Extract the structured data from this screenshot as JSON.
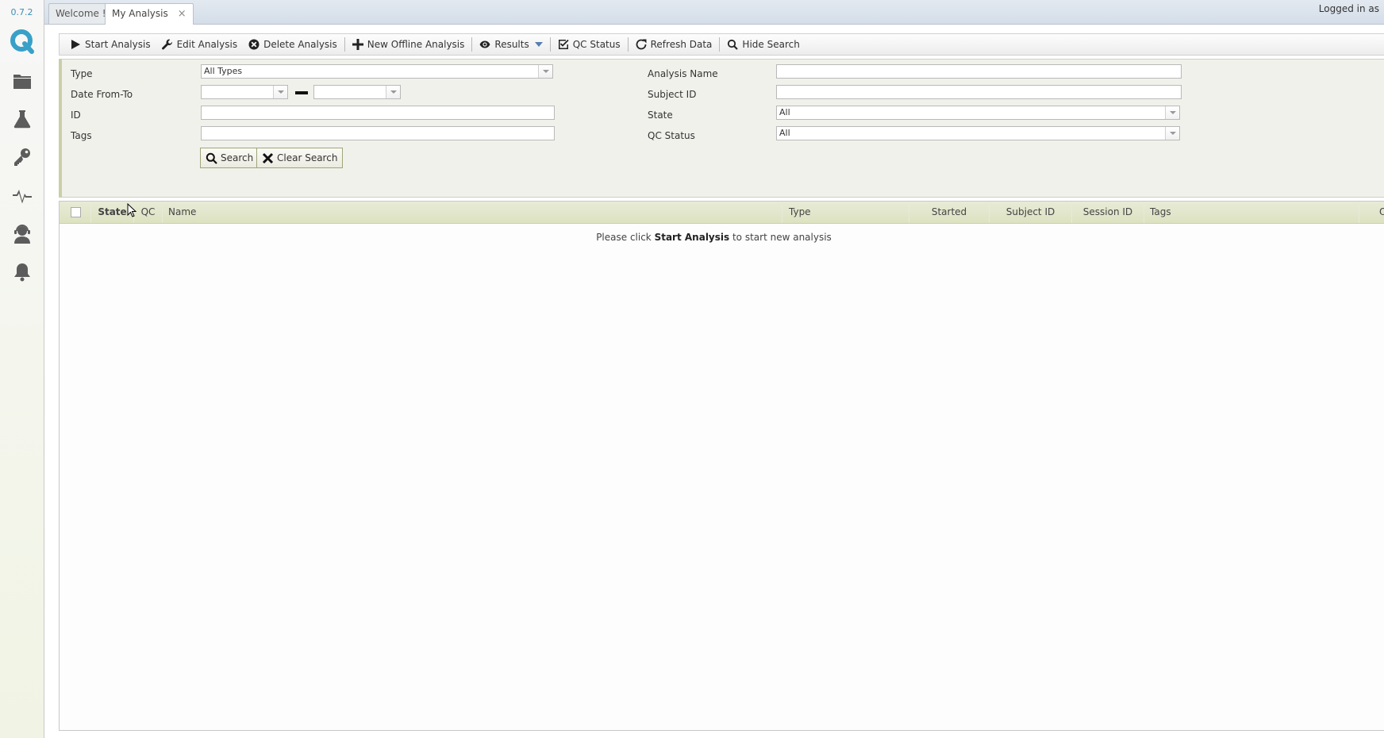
{
  "app": {
    "version": "0.7.2"
  },
  "sidebar": {
    "items": [
      {
        "icon": "folder-icon"
      },
      {
        "icon": "flask-icon"
      },
      {
        "icon": "key-icon"
      },
      {
        "icon": "pulse-icon"
      },
      {
        "icon": "support-agent-icon"
      },
      {
        "icon": "bell-icon"
      }
    ]
  },
  "tabs": [
    {
      "label": "Welcome !"
    },
    {
      "label": "My Analysis",
      "close": "×"
    }
  ],
  "header": {
    "login_text": "Logged in as"
  },
  "toolbar": {
    "start": "Start Analysis",
    "edit": "Edit Analysis",
    "delete": "Delete Analysis",
    "offline": "New Offline Analysis",
    "results": "Results",
    "qc": "QC Status",
    "refresh": "Refresh Data",
    "hide": "Hide Search"
  },
  "search": {
    "type_label": "Type",
    "type_value": "All Types",
    "date_label": "Date From-To",
    "date_from": "",
    "date_to": "",
    "id_label": "ID",
    "id_value": "",
    "tags_label": "Tags",
    "tags_value": "",
    "name_label": "Analysis Name",
    "name_value": "",
    "subject_label": "Subject ID",
    "subject_value": "",
    "state_label": "State",
    "state_value": "All",
    "qc_label": "QC Status",
    "qc_value": "All",
    "search_btn": "Search",
    "clear_btn": "Clear Search"
  },
  "grid": {
    "columns": {
      "state": "State",
      "qc": "QC",
      "name": "Name",
      "type": "Type",
      "started": "Started",
      "subject": "Subject ID",
      "session": "Session ID",
      "tags": "Tags",
      "last": "O"
    },
    "empty_prefix": "Please click ",
    "empty_action": "Start Analysis",
    "empty_suffix": " to start new analysis"
  }
}
